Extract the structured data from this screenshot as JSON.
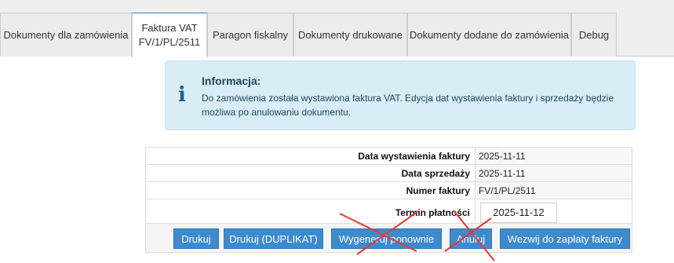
{
  "tabs": [
    {
      "label": "Dokumenty dla zamówienia",
      "sub": ""
    },
    {
      "label": "Faktura VAT",
      "sub": "FV/1/PL/2511"
    },
    {
      "label": "Paragon fiskalny",
      "sub": ""
    },
    {
      "label": "Dokumenty drukowane",
      "sub": ""
    },
    {
      "label": "Dokumenty dodane do zamówienia",
      "sub": ""
    },
    {
      "label": "Debug",
      "sub": ""
    }
  ],
  "info": {
    "title": "Informacja:",
    "text": "Do zamówienia została wystawiona faktura VAT. Edycja dat wystawienia faktury i sprzedaży będzie możliwa po anulowaniu dokumentu.",
    "icon": "info-icon"
  },
  "invoice": {
    "issue_date_label": "Data wystawienia faktury",
    "issue_date": "2025-11-11",
    "sale_date_label": "Data sprzedaży",
    "sale_date": "2025-11-11",
    "number_label": "Numer faktury",
    "number": "FV/1/PL/2511",
    "due_label": "Termin płatności",
    "due_date": "2025-11-12"
  },
  "buttons": {
    "print": "Drukuj",
    "print_duplicate": "Drukuj (DUPLIKAT)",
    "regenerate": "Wygeneruj ponownie",
    "cancel": "Anuluj",
    "payment_request": "Wezwij do zapłaty faktury"
  },
  "colors": {
    "active_tab_border": "#2f7fc9",
    "info_bg": "#d9edf7",
    "button": "#3e8acd",
    "strike": "#e53935"
  }
}
